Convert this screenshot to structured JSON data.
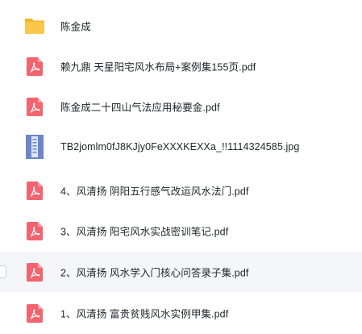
{
  "files": [
    {
      "name": "陈金成",
      "icon": "folder-icon"
    },
    {
      "name": "赖九鼎 天星阳宅风水布局+案例集155页.pdf",
      "icon": "pdf-icon"
    },
    {
      "name": "陈金成二十四山气法应用秘要金.pdf",
      "icon": "pdf-icon"
    },
    {
      "name": "TB2jomlm0fJ8KJjy0FeXXXKEXXa_!!1114324585.jpg",
      "icon": "image-thumbnail-icon"
    },
    {
      "name": "4、风清扬 阴阳五行感气改运风水法门.pdf",
      "icon": "pdf-icon"
    },
    {
      "name": "3、风清扬 阳宅风水实战密训笔记.pdf",
      "icon": "pdf-icon"
    },
    {
      "name": "2、风清扬 风水学入门核心问答录子集.pdf",
      "icon": "pdf-icon",
      "hovered": true
    },
    {
      "name": "1、风清扬 富贵贫贱风水实例甲集.pdf",
      "icon": "pdf-icon"
    }
  ],
  "colors": {
    "pdf": "#f2646f",
    "folder": "#f7c33c",
    "hover_row": "#f5f6fa"
  }
}
